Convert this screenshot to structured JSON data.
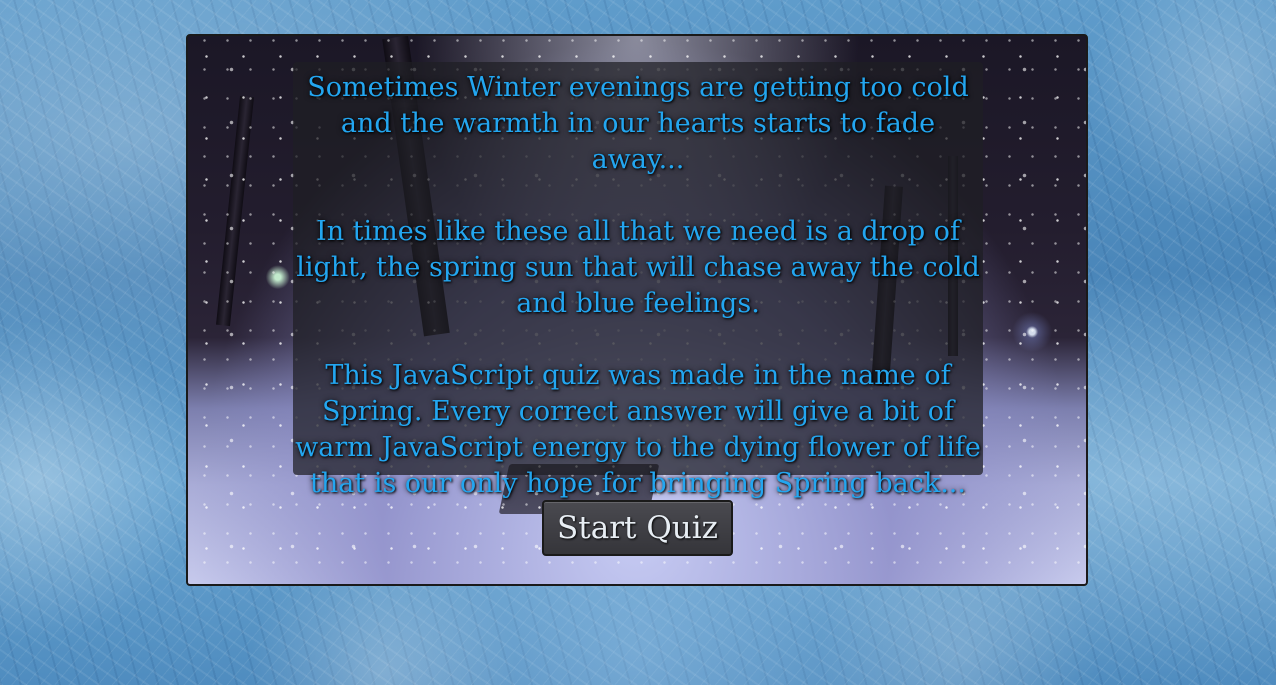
{
  "intro": {
    "paragraphs": [
      "Sometimes Winter evenings are getting too cold and the warmth in our hearts starts to fade away...",
      "In times like these all that we need is a drop of light, the spring sun that will chase away the cold and blue feelings.",
      "This JavaScript quiz was made in the name of Spring. Every correct answer will give a bit of warm JavaScript energy to the dying flower of life that is our only hope for bringing Spring back..."
    ]
  },
  "start_button": {
    "label": "Start Quiz"
  },
  "colors": {
    "text_accent": "#23a6f0",
    "button_bg": "#3a3a3f",
    "button_text": "#e8eef4"
  }
}
